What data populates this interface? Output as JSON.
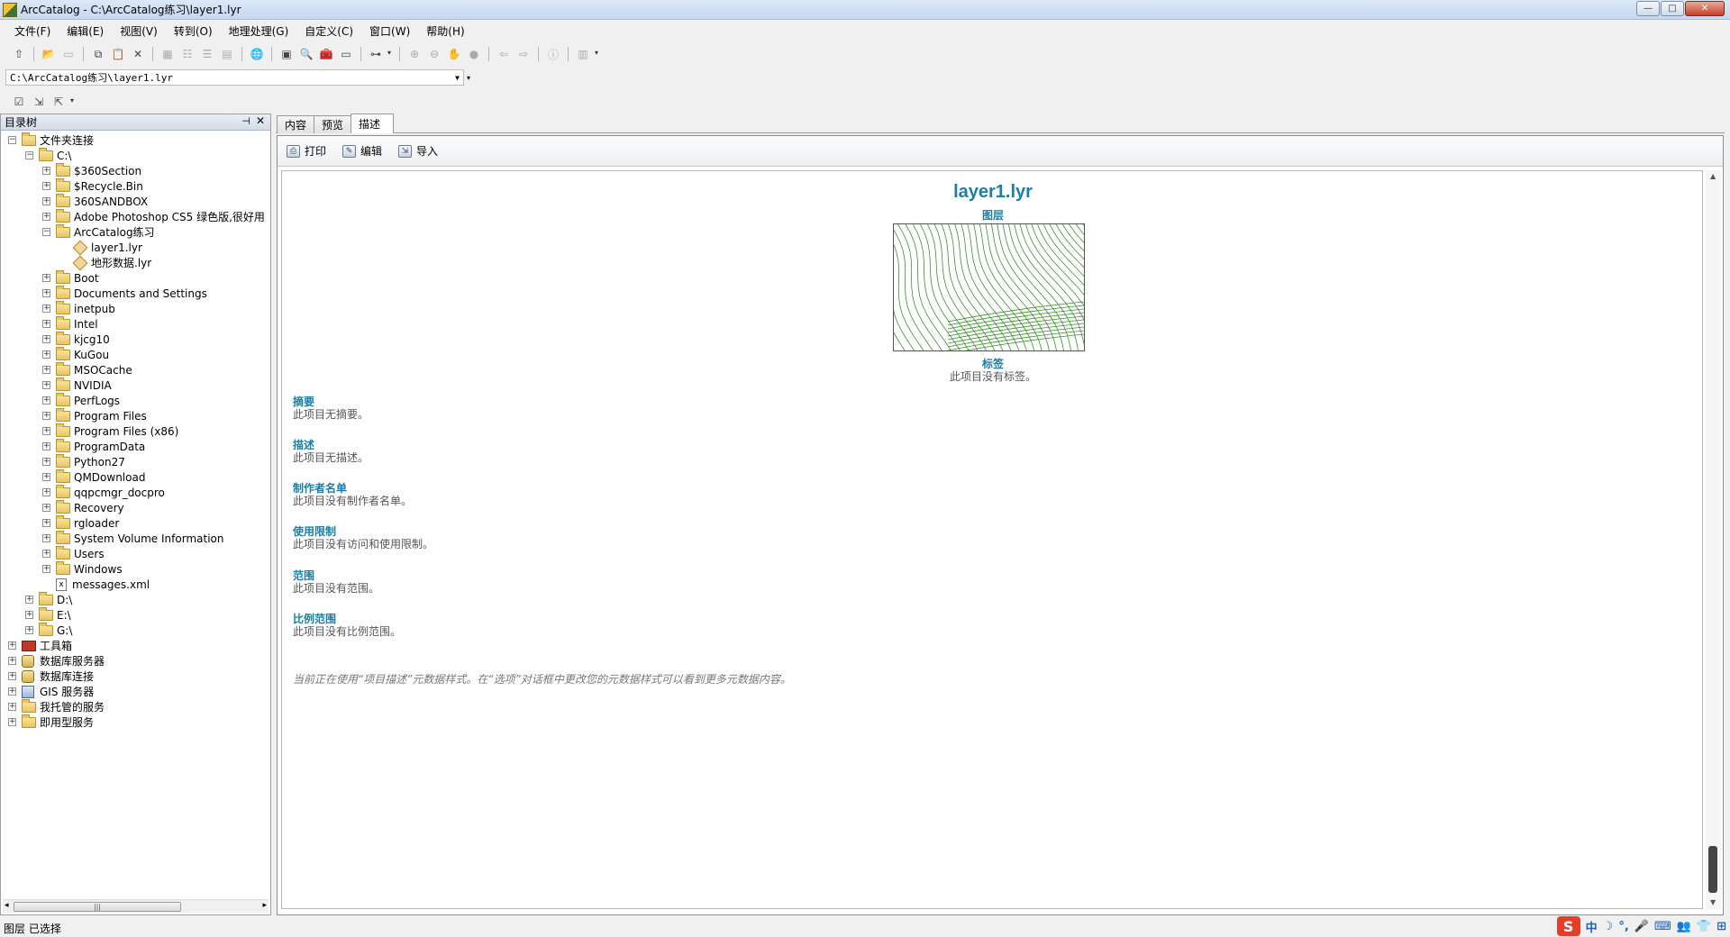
{
  "window": {
    "title": "ArcCatalog - C:\\ArcCatalog练习\\layer1.lyr",
    "controls": {
      "minimize": "—",
      "maximize": "□",
      "close": "✕"
    }
  },
  "menu": [
    "文件(F)",
    "编辑(E)",
    "视图(V)",
    "转到(O)",
    "地理处理(G)",
    "自定义(C)",
    "窗口(W)",
    "帮助(H)"
  ],
  "location": {
    "value": "C:\\ArcCatalog练习\\layer1.lyr"
  },
  "tree": {
    "header": "目录树",
    "items": [
      {
        "label": "文件夹连接",
        "level": 0,
        "expander": "minus",
        "icon": "folder-connection-icon"
      },
      {
        "label": "C:\\",
        "level": 1,
        "expander": "minus",
        "icon": "folder-icon"
      },
      {
        "label": "$360Section",
        "level": 2,
        "expander": "plus",
        "icon": "folder-icon"
      },
      {
        "label": "$Recycle.Bin",
        "level": 2,
        "expander": "plus",
        "icon": "folder-icon"
      },
      {
        "label": "360SANDBOX",
        "level": 2,
        "expander": "plus",
        "icon": "folder-icon"
      },
      {
        "label": "Adobe Photoshop CS5 绿色版,很好用",
        "level": 2,
        "expander": "plus",
        "icon": "folder-icon"
      },
      {
        "label": "ArcCatalog练习",
        "level": 2,
        "expander": "minus",
        "icon": "folder-icon"
      },
      {
        "label": "layer1.lyr",
        "level": 3,
        "expander": "none",
        "icon": "layer-icon"
      },
      {
        "label": "地形数据.lyr",
        "level": 3,
        "expander": "none",
        "icon": "layer-icon"
      },
      {
        "label": "Boot",
        "level": 2,
        "expander": "plus",
        "icon": "folder-icon"
      },
      {
        "label": "Documents and Settings",
        "level": 2,
        "expander": "plus",
        "icon": "folder-icon"
      },
      {
        "label": "inetpub",
        "level": 2,
        "expander": "plus",
        "icon": "folder-icon"
      },
      {
        "label": "Intel",
        "level": 2,
        "expander": "plus",
        "icon": "folder-icon"
      },
      {
        "label": "kjcg10",
        "level": 2,
        "expander": "plus",
        "icon": "folder-icon"
      },
      {
        "label": "KuGou",
        "level": 2,
        "expander": "plus",
        "icon": "folder-icon"
      },
      {
        "label": "MSOCache",
        "level": 2,
        "expander": "plus",
        "icon": "folder-icon"
      },
      {
        "label": "NVIDIA",
        "level": 2,
        "expander": "plus",
        "icon": "folder-icon"
      },
      {
        "label": "PerfLogs",
        "level": 2,
        "expander": "plus",
        "icon": "folder-icon"
      },
      {
        "label": "Program Files",
        "level": 2,
        "expander": "plus",
        "icon": "folder-icon"
      },
      {
        "label": "Program Files (x86)",
        "level": 2,
        "expander": "plus",
        "icon": "folder-icon"
      },
      {
        "label": "ProgramData",
        "level": 2,
        "expander": "plus",
        "icon": "folder-icon"
      },
      {
        "label": "Python27",
        "level": 2,
        "expander": "plus",
        "icon": "folder-icon"
      },
      {
        "label": "QMDownload",
        "level": 2,
        "expander": "plus",
        "icon": "folder-icon"
      },
      {
        "label": "qqpcmgr_docpro",
        "level": 2,
        "expander": "plus",
        "icon": "folder-icon"
      },
      {
        "label": "Recovery",
        "level": 2,
        "expander": "plus",
        "icon": "folder-icon"
      },
      {
        "label": "rgloader",
        "level": 2,
        "expander": "plus",
        "icon": "folder-icon"
      },
      {
        "label": "System Volume Information",
        "level": 2,
        "expander": "plus",
        "icon": "folder-icon"
      },
      {
        "label": "Users",
        "level": 2,
        "expander": "plus",
        "icon": "folder-icon"
      },
      {
        "label": "Windows",
        "level": 2,
        "expander": "plus",
        "icon": "folder-icon"
      },
      {
        "label": "messages.xml",
        "level": 2,
        "expander": "none",
        "icon": "xml-file-icon"
      },
      {
        "label": "D:\\",
        "level": 1,
        "expander": "plus",
        "icon": "folder-icon"
      },
      {
        "label": "E:\\",
        "level": 1,
        "expander": "plus",
        "icon": "folder-icon"
      },
      {
        "label": "G:\\",
        "level": 1,
        "expander": "plus",
        "icon": "folder-icon"
      },
      {
        "label": "工具箱",
        "level": 0,
        "expander": "plus",
        "icon": "toolbox-icon"
      },
      {
        "label": "数据库服务器",
        "level": 0,
        "expander": "plus",
        "icon": "database-server-icon"
      },
      {
        "label": "数据库连接",
        "level": 0,
        "expander": "plus",
        "icon": "database-connection-icon"
      },
      {
        "label": "GIS 服务器",
        "level": 0,
        "expander": "plus",
        "icon": "gis-server-icon"
      },
      {
        "label": "我托管的服务",
        "level": 0,
        "expander": "plus",
        "icon": "hosted-services-icon"
      },
      {
        "label": "即用型服务",
        "level": 0,
        "expander": "plus",
        "icon": "ready-services-icon"
      }
    ]
  },
  "tabs": [
    {
      "label": "内容",
      "active": false
    },
    {
      "label": "预览",
      "active": false
    },
    {
      "label": "描述",
      "active": true
    }
  ],
  "desc_toolbar": {
    "print": "打印",
    "edit": "编辑",
    "import": "导入"
  },
  "document": {
    "title": "layer1.lyr",
    "type": "图层",
    "tags_heading": "标签",
    "tags_text": "此项目没有标签。",
    "sections": [
      {
        "heading": "摘要",
        "text": "此项目无摘要。"
      },
      {
        "heading": "描述",
        "text": "此项目无描述。"
      },
      {
        "heading": "制作者名单",
        "text": "此项目没有制作者名单。"
      },
      {
        "heading": "使用限制",
        "text": "此项目没有访问和使用限制。"
      },
      {
        "heading": "范围",
        "text": "此项目没有范围。"
      },
      {
        "heading": "比例范围",
        "text": "此项目没有比例范围。"
      }
    ],
    "footnote": "当前正在使用“项目描述”元数据样式。在“选项”对话框中更改您的元数据样式可以看到更多元数据内容。"
  },
  "status": {
    "text": "图层 已选择"
  },
  "ime": {
    "logo": "S",
    "lang": "中",
    "items": [
      "☽",
      "°,",
      "🎤",
      "⌨",
      "👥",
      "👕",
      "⊞"
    ]
  },
  "colors": {
    "heading": "#1a7fa6",
    "contour": "#3f8f2f"
  }
}
